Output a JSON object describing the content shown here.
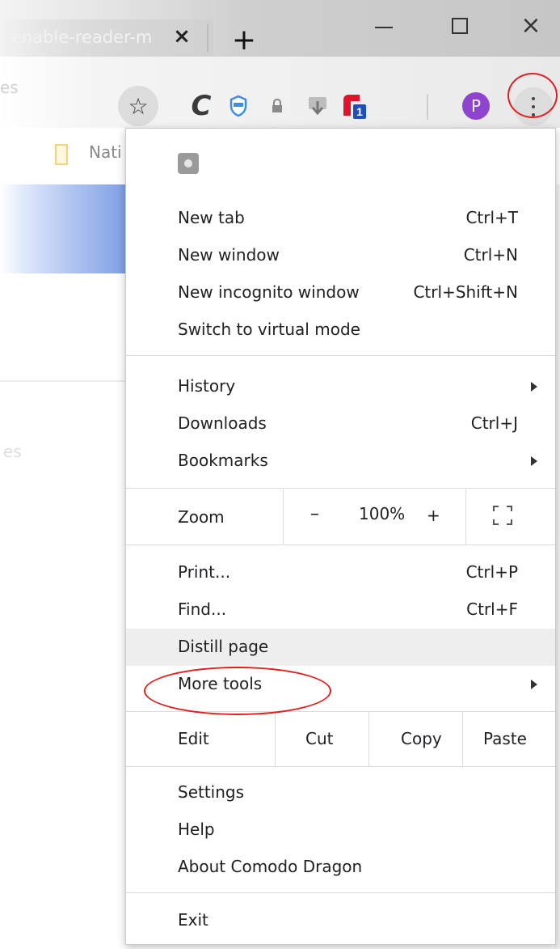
{
  "tab": {
    "title": "enable-reader-m",
    "close": "×",
    "new_tab": "+"
  },
  "window": {
    "close": "×"
  },
  "toolbar": {
    "omnibox_fragment": "es",
    "star": "☆",
    "c_ext": "C",
    "lock": "🔒",
    "red_ext_badge": "1",
    "avatar_letter": "P"
  },
  "bookmarks": {
    "item_label": "Nati"
  },
  "page": {
    "faded_text": "es"
  },
  "menu": {
    "items_group1": [
      {
        "label": "New tab",
        "shortcut": "Ctrl+T"
      },
      {
        "label": "New window",
        "shortcut": "Ctrl+N"
      },
      {
        "label": "New incognito window",
        "shortcut": "Ctrl+Shift+N"
      },
      {
        "label": "Switch to virtual mode",
        "shortcut": ""
      }
    ],
    "items_group2": [
      {
        "label": "History",
        "shortcut": ""
      },
      {
        "label": "Downloads",
        "shortcut": "Ctrl+J"
      },
      {
        "label": "Bookmarks",
        "shortcut": ""
      }
    ],
    "zoom": {
      "label": "Zoom",
      "minus": "–",
      "value": "100%",
      "plus": "+"
    },
    "items_group3": [
      {
        "label": "Print...",
        "shortcut": "Ctrl+P"
      },
      {
        "label": "Find...",
        "shortcut": "Ctrl+F"
      },
      {
        "label": "Distill page",
        "shortcut": ""
      },
      {
        "label": "More tools",
        "shortcut": ""
      }
    ],
    "edit": {
      "label": "Edit",
      "cut": "Cut",
      "copy": "Copy",
      "paste": "Paste"
    },
    "items_group4": [
      {
        "label": "Settings"
      },
      {
        "label": "Help"
      },
      {
        "label": "About Comodo Dragon"
      }
    ],
    "exit": "Exit"
  },
  "colors": {
    "annotation": "#e02020",
    "avatar": "#8e44ce",
    "banner": "#7f9fe4",
    "highlight": "#eeeeee"
  },
  "icons": [
    "star-icon",
    "comodo-c-icon",
    "shield-icon",
    "lock-icon",
    "download-icon",
    "red-extension-icon",
    "three-dot-menu-icon",
    "fullscreen-icon",
    "submenu-arrow-icon"
  ]
}
